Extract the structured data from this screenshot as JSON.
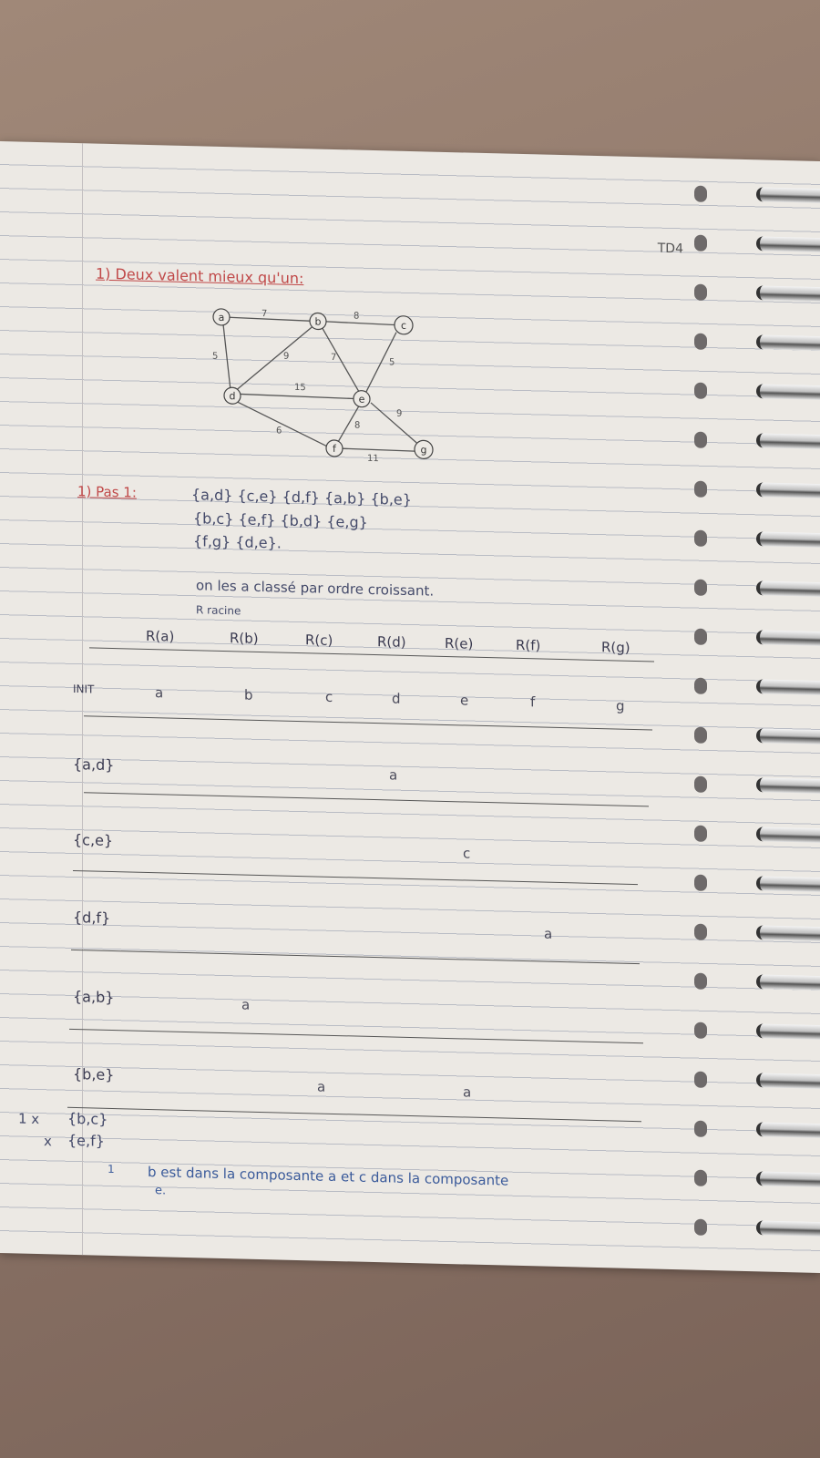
{
  "header": {
    "td_tag": "TD4"
  },
  "exercise": {
    "title": "1) Deux valent mieux qu'un:"
  },
  "graph": {
    "nodes": [
      "a",
      "b",
      "c",
      "d",
      "e",
      "f",
      "g"
    ],
    "edges": [
      {
        "from": "a",
        "to": "b",
        "weight": "7"
      },
      {
        "from": "b",
        "to": "c",
        "weight": "8"
      },
      {
        "from": "a",
        "to": "d",
        "weight": "5"
      },
      {
        "from": "d",
        "to": "b",
        "weight": "9"
      },
      {
        "from": "b",
        "to": "e",
        "weight": "7"
      },
      {
        "from": "c",
        "to": "e",
        "weight": "5"
      },
      {
        "from": "d",
        "to": "e",
        "weight": "15"
      },
      {
        "from": "e",
        "to": "g",
        "weight": "9"
      },
      {
        "from": "e",
        "to": "f",
        "weight": "8"
      },
      {
        "from": "d",
        "to": "f",
        "weight": "6"
      },
      {
        "from": "f",
        "to": "g",
        "weight": "11"
      }
    ]
  },
  "pas1": {
    "label": "1) Pas 1:",
    "line1": "{a,d} {c,e} {d,f} {a,b} {b,e}",
    "line2": "{b,c} {e,f} {b,d} {e,g}",
    "line3": "{f,g} {d,e}.",
    "note": "on les a classé par ordre croissant.",
    "racine": "R racine"
  },
  "table": {
    "headers": [
      "R(a)",
      "R(b)",
      "R(c)",
      "R(d)",
      "R(e)",
      "R(f)",
      "R(g)"
    ],
    "rows": [
      {
        "label": "INIT",
        "cells": [
          "a",
          "b",
          "c",
          "d",
          "e",
          "f",
          "g"
        ]
      },
      {
        "label": "{a,d}",
        "cells": [
          "",
          "",
          "",
          "a",
          "",
          "",
          ""
        ]
      },
      {
        "label": "{c,e}",
        "cells": [
          "",
          "",
          "",
          "",
          "c",
          "",
          ""
        ]
      },
      {
        "label": "{d,f}",
        "cells": [
          "",
          "",
          "",
          "",
          "",
          "a",
          ""
        ]
      },
      {
        "label": "{a,b}",
        "cells": [
          "",
          "a",
          "",
          "",
          "",
          "",
          ""
        ]
      },
      {
        "label": "{b,e}",
        "cells": [
          "",
          "",
          "a",
          "",
          "a",
          "",
          ""
        ]
      }
    ]
  },
  "rejected": [
    {
      "prefix": "1 x",
      "label": "{b,c}"
    },
    {
      "prefix": "x",
      "label": "{e,f}"
    }
  ],
  "footnote": {
    "marker": "1",
    "line1": "b est dans la composante a   et  c dans la composante",
    "line2": "e."
  }
}
